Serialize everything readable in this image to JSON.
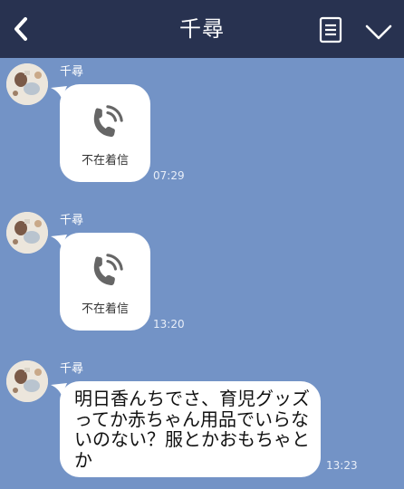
{
  "header": {
    "title": "千尋",
    "background_color": "#283250",
    "back_icon": "chevron-left-icon",
    "menu_icon": "memo-list-icon",
    "expand_icon": "chevron-down-icon"
  },
  "chat_background": "#7393c6",
  "messages": [
    {
      "type": "missed_call",
      "sender": "千尋",
      "label": "不在着信",
      "time": "07:29",
      "icon": "phone-icon"
    },
    {
      "type": "missed_call",
      "sender": "千尋",
      "label": "不在着信",
      "time": "13:20",
      "icon": "phone-icon"
    },
    {
      "type": "text",
      "sender": "千尋",
      "text": "明日香んちでさ、育児グッズってか赤ちゃん用品でいらないのない？服とかおもちゃとか",
      "time": "13:23"
    }
  ]
}
